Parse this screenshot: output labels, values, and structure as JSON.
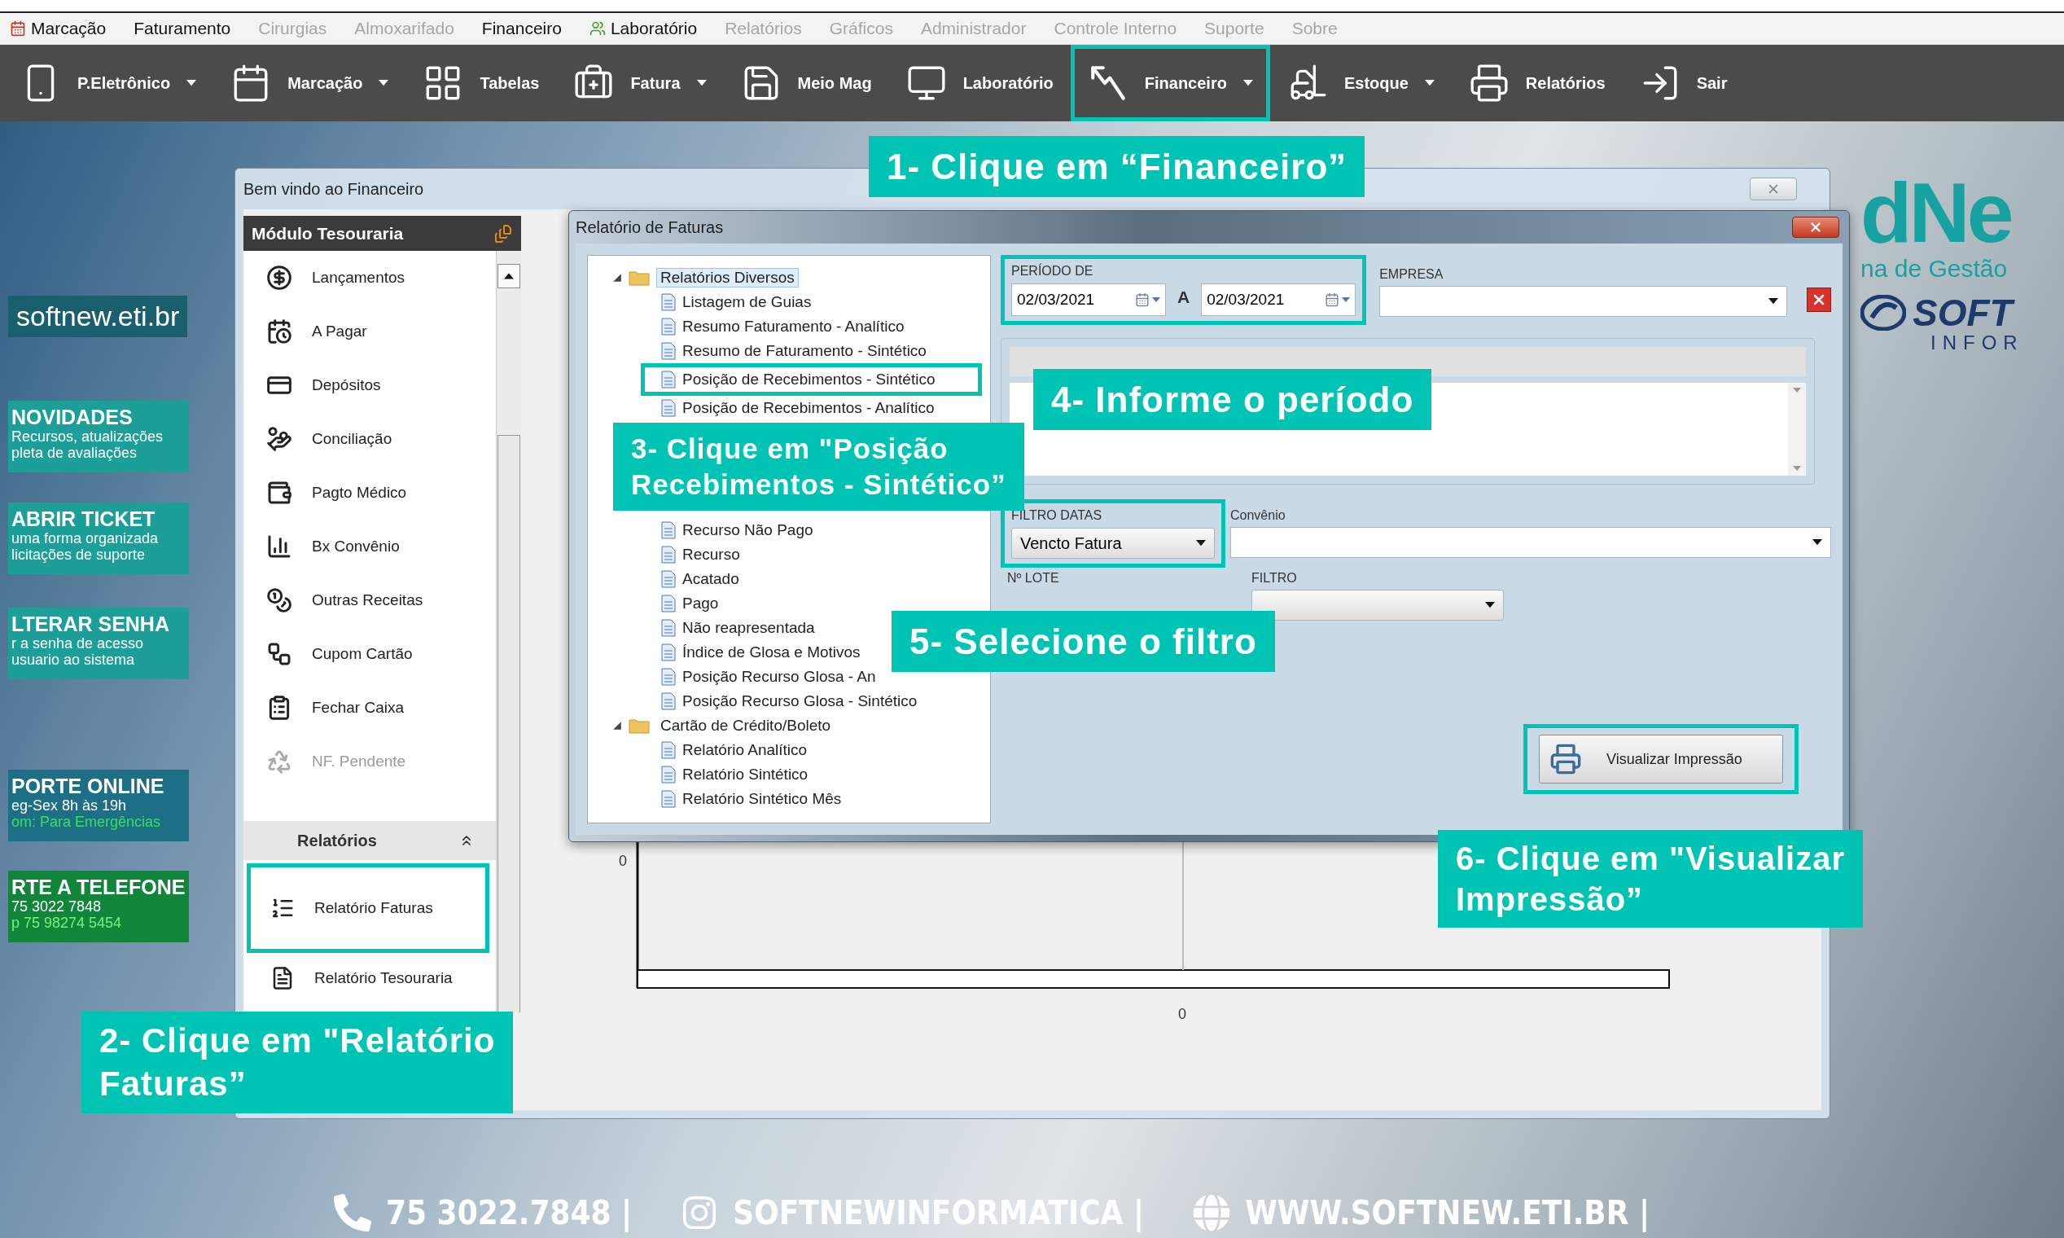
{
  "menu_bar": [
    {
      "label": "Marcação",
      "kind": "icon",
      "disabled": false
    },
    {
      "label": "Faturamento",
      "kind": "plain",
      "disabled": false
    },
    {
      "label": "Cirurgias",
      "kind": "plain",
      "disabled": true
    },
    {
      "label": "Almoxarifado",
      "kind": "plain",
      "disabled": true
    },
    {
      "label": "Financeiro",
      "kind": "plain",
      "disabled": false
    },
    {
      "label": "Laboratório",
      "kind": "icon",
      "disabled": false
    },
    {
      "label": "Relatórios",
      "kind": "plain",
      "disabled": true
    },
    {
      "label": "Gráficos",
      "kind": "plain",
      "disabled": true
    },
    {
      "label": "Administrador",
      "kind": "plain",
      "disabled": true
    },
    {
      "label": "Controle Interno",
      "kind": "plain",
      "disabled": true
    },
    {
      "label": "Suporte",
      "kind": "plain",
      "disabled": true
    },
    {
      "label": "Sobre",
      "kind": "plain",
      "disabled": true
    }
  ],
  "toolbar": [
    {
      "label": "P.Eletrônico",
      "dropdown": true,
      "highlighted": false
    },
    {
      "label": "Marcação",
      "dropdown": true,
      "highlighted": false
    },
    {
      "label": "Tabelas",
      "dropdown": false,
      "highlighted": false
    },
    {
      "label": "Fatura",
      "dropdown": true,
      "highlighted": false
    },
    {
      "label": "Meio Mag",
      "dropdown": false,
      "highlighted": false
    },
    {
      "label": "Laboratório",
      "dropdown": false,
      "highlighted": false
    },
    {
      "label": "Financeiro",
      "dropdown": true,
      "highlighted": true
    },
    {
      "label": "Estoque",
      "dropdown": true,
      "highlighted": false
    },
    {
      "label": "Relatórios",
      "dropdown": false,
      "highlighted": false
    },
    {
      "label": "Sair",
      "dropdown": false,
      "highlighted": false
    }
  ],
  "wallpaper": {
    "site": "softnew.eti.br",
    "banners": [
      {
        "title": "NOVIDADES",
        "color": "#1b9f98",
        "lines": [
          {
            "text": "Recursos, atualizações",
            "color": "#ffffff"
          },
          {
            "text": "pleta de avaliações",
            "color": "#ffffff"
          }
        ]
      },
      {
        "title": "ABRIR TICKET",
        "color": "#1b9f98",
        "lines": [
          {
            "text": "uma forma organizada",
            "color": "#ffffff"
          },
          {
            "text": "licitações de suporte",
            "color": "#ffffff"
          }
        ]
      },
      {
        "title": "LTERAR SENHA",
        "color": "#1b9f98",
        "lines": [
          {
            "text": "r a senha de acesso",
            "color": "#ffffff"
          },
          {
            "text": "usuario ao sistema",
            "color": "#ffffff"
          }
        ]
      },
      {
        "title": "PORTE ONLINE",
        "color": "#1d6f86",
        "lines": [
          {
            "text": "eg-Sex 8h às 19h",
            "color": "#ffffff"
          },
          {
            "text": "om: Para Emergências",
            "color": "#39e05a"
          }
        ]
      },
      {
        "title": "RTE A TELEFONE",
        "color": "#11863a",
        "lines": [
          {
            "text": "75 3022 7848",
            "color": "#ffffff"
          },
          {
            "text": "p 75 98274 5454",
            "color": "#7cf07a"
          }
        ]
      }
    ],
    "brand": {
      "name": "dNe",
      "tagline": "na de Gestão",
      "logo_word": "SOFT",
      "logo_subword": "INFOR"
    },
    "footer": [
      {
        "text": "75 3022.7848 |"
      },
      {
        "text": "SOFTNEWINFORMATICA |"
      },
      {
        "text": "WWW.SOFTNEW.ETI.BR |"
      }
    ]
  },
  "main_window": {
    "title": "Bem vindo ao Financeiro",
    "module_panel": {
      "title": "Módulo Tesouraria",
      "items": [
        {
          "label": "Lançamentos",
          "disabled": false
        },
        {
          "label": "A Pagar",
          "disabled": false
        },
        {
          "label": "Depósitos",
          "disabled": false
        },
        {
          "label": "Conciliação",
          "disabled": false
        },
        {
          "label": "Pagto Médico",
          "disabled": false
        },
        {
          "label": "Bx Convênio",
          "disabled": false
        },
        {
          "label": "Outras Receitas",
          "disabled": false
        },
        {
          "label": "Cupom Cartão",
          "disabled": false
        },
        {
          "label": "Fechar Caixa",
          "disabled": false
        },
        {
          "label": "NF. Pendente",
          "disabled": true
        }
      ],
      "section": {
        "title": "Relatórios",
        "expanded": true,
        "items": [
          {
            "label": "Relatório Faturas",
            "highlighted": true
          },
          {
            "label": "Relatório Tesouraria",
            "highlighted": false
          }
        ]
      }
    },
    "chart": {
      "y_tick_label": "0",
      "x_tick_label": "0"
    }
  },
  "report_dialog": {
    "title": "Relatório de Faturas",
    "tree": [
      {
        "label": "Relatórios Diversos",
        "expanded": true,
        "selected": true,
        "children": [
          {
            "label": "Listagem de Guias",
            "highlighted": false,
            "gap_after": false
          },
          {
            "label": "Resumo Faturamento - Analítico",
            "highlighted": false,
            "gap_after": false
          },
          {
            "label": "Resumo de Faturamento - Sintético",
            "highlighted": false,
            "gap_after": false
          },
          {
            "label": "Posição de Recebimentos - Sintético",
            "highlighted": true,
            "gap_after": false
          },
          {
            "label": "Posição de Recebimentos - Analítico",
            "highlighted": false,
            "gap_after": true
          },
          {
            "label": "Recurso Não Pago",
            "highlighted": false,
            "gap_after": false
          },
          {
            "label": "Recurso",
            "highlighted": false,
            "gap_after": false
          },
          {
            "label": "Acatado",
            "highlighted": false,
            "gap_after": false
          },
          {
            "label": "Pago",
            "highlighted": false,
            "gap_after": false
          },
          {
            "label": "Não reapresentada",
            "highlighted": false,
            "gap_after": false
          },
          {
            "label": "Índice de Glosa e Motivos",
            "highlighted": false,
            "gap_after": false
          },
          {
            "label": "Posição Recurso Glosa - An",
            "highlighted": false,
            "gap_after": false
          },
          {
            "label": "Posição Recurso Glosa - Sintético",
            "highlighted": false,
            "gap_after": false
          }
        ]
      },
      {
        "label": "Cartão de Crédito/Boleto",
        "expanded": true,
        "selected": false,
        "children": [
          {
            "label": "Relatório Analítico",
            "highlighted": false,
            "gap_after": false
          },
          {
            "label": "Relatório Sintético",
            "highlighted": false,
            "gap_after": false
          },
          {
            "label": "Relatório Sintético Mês",
            "highlighted": false,
            "gap_after": false
          }
        ]
      }
    ],
    "form": {
      "period": {
        "label": "PERÍODO DE",
        "from": "02/03/2021",
        "separator": "A",
        "to": "02/03/2021",
        "highlighted": true
      },
      "company": {
        "label": "EMPRESA"
      },
      "date_filter": {
        "label": "FILTRO DATAS",
        "value": "Vencto Fatura",
        "highlighted": true
      },
      "agreement": {
        "label": "Convênio"
      },
      "batch": {
        "label": "Nº LOTE"
      },
      "filter": {
        "label": "FILTRO"
      }
    },
    "preview_button": {
      "label": "Visualizar Impressão",
      "highlighted": true
    }
  },
  "callouts": [
    {
      "text": "1- Clique em “Financeiro”"
    },
    {
      "text": "2- Clique em \"Relatório\nFaturas”"
    },
    {
      "text": "3- Clique em \"Posição\nRecebimentos - Sintético”"
    },
    {
      "text": "4- Informe o período"
    },
    {
      "text": "5- Selecione o filtro"
    },
    {
      "text": "6- Clique em \"Visualizar\nImpressão”"
    }
  ]
}
